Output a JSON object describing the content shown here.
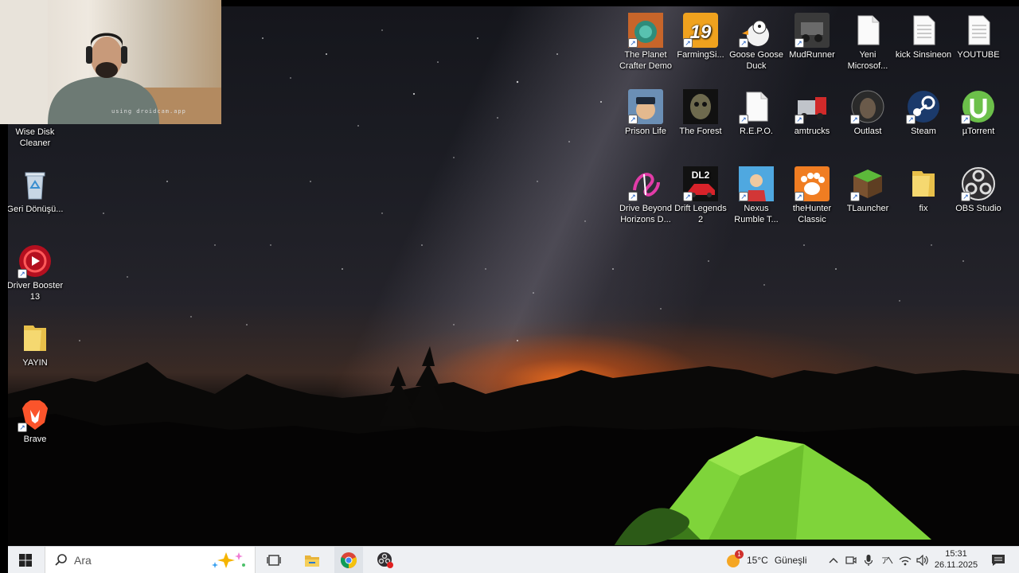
{
  "webcam": {
    "caption": "using droidcam.app"
  },
  "desktop_left": [
    {
      "label": "Wise Disk Cleaner",
      "icon": "wise-disk-cleaner-icon"
    },
    {
      "label": "Geri Dönüşü...",
      "icon": "recycle-bin-icon"
    },
    {
      "label": "Driver Booster 13",
      "icon": "driver-booster-icon"
    },
    {
      "label": "YAYIN",
      "icon": "folder-icon"
    },
    {
      "label": "Brave",
      "icon": "brave-icon"
    }
  ],
  "desktop_grid": [
    {
      "label": "The Planet Crafter Demo",
      "icon": "planet-crafter-icon"
    },
    {
      "label": "FarmingSi...",
      "icon": "farming-simulator-icon",
      "badge": "19"
    },
    {
      "label": "Goose Goose Duck",
      "icon": "goose-goose-duck-icon"
    },
    {
      "label": "MudRunner",
      "icon": "mudrunner-icon"
    },
    {
      "label": "Yeni Microsof...",
      "icon": "document-icon"
    },
    {
      "label": "kick Sinsineon",
      "icon": "text-file-icon"
    },
    {
      "label": "YOUTUBE",
      "icon": "text-file-icon"
    },
    {
      "label": "Prison Life",
      "icon": "prison-life-icon"
    },
    {
      "label": "The Forest",
      "icon": "the-forest-icon"
    },
    {
      "label": "R.E.P.O.",
      "icon": "document-icon"
    },
    {
      "label": "amtrucks",
      "icon": "american-truck-icon"
    },
    {
      "label": "Outlast",
      "icon": "outlast-icon"
    },
    {
      "label": "Steam",
      "icon": "steam-icon"
    },
    {
      "label": "µTorrent",
      "icon": "utorrent-icon"
    },
    {
      "label": "Drive Beyond Horizons D...",
      "icon": "drive-beyond-horizons-icon"
    },
    {
      "label": "Drift Legends 2",
      "icon": "drift-legends-icon",
      "badge": "DL2"
    },
    {
      "label": "Nexus Rumble T...",
      "icon": "nexus-rumble-icon"
    },
    {
      "label": "theHunter Classic",
      "icon": "thehunter-icon"
    },
    {
      "label": "TLauncher",
      "icon": "tlauncher-icon"
    },
    {
      "label": "fix",
      "icon": "folder-icon"
    },
    {
      "label": "OBS Studio",
      "icon": "obs-icon"
    }
  ],
  "taskbar": {
    "search_placeholder": "Ara",
    "weather_temp": "15°C",
    "weather_text": "Güneşli",
    "weather_badge": "1",
    "time": "15:31",
    "date": "26.11.2025"
  },
  "colors": {
    "taskbar": "#eef0f3",
    "tent": "#7fd43a",
    "horizon": "#f06e1e"
  }
}
